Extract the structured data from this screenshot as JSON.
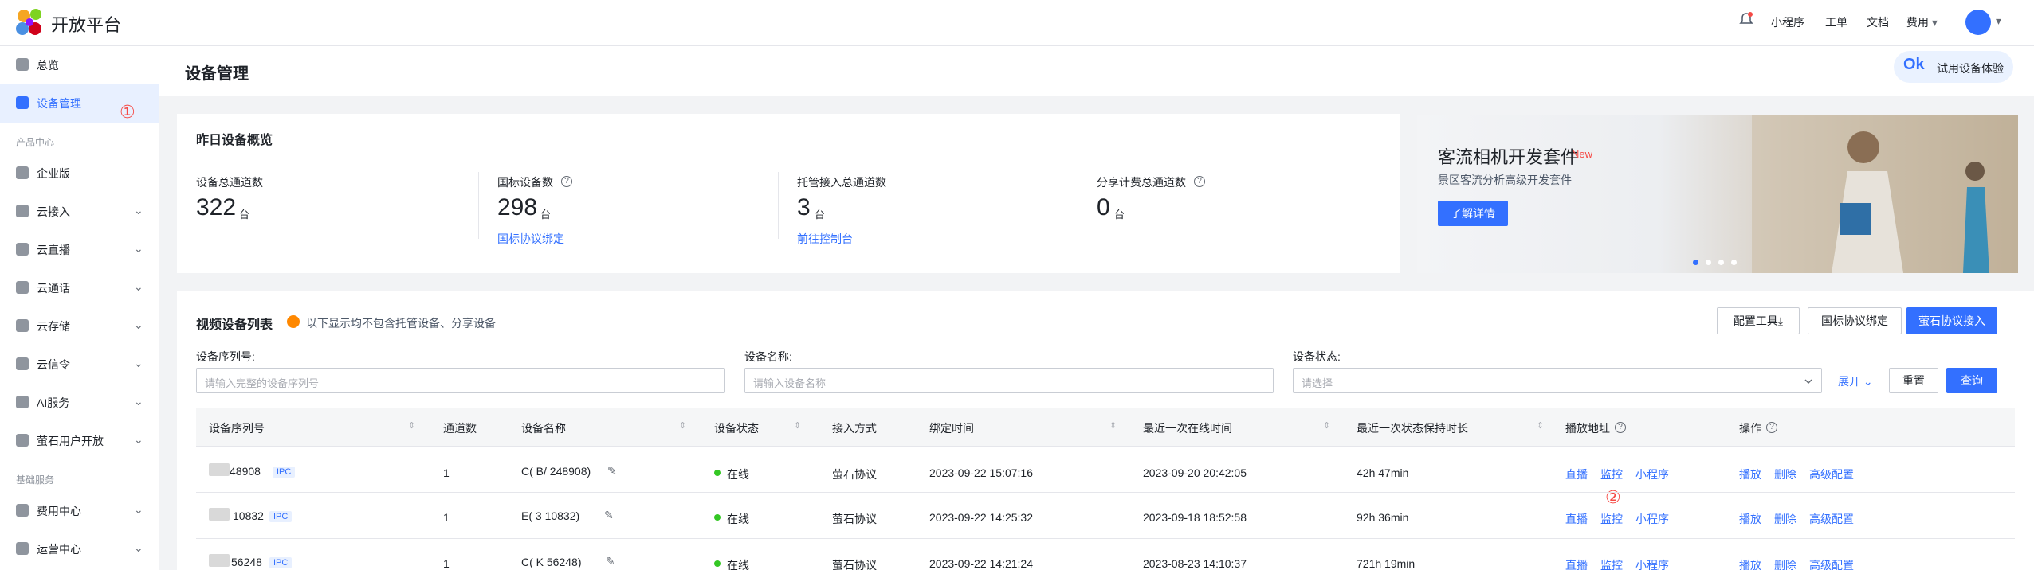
{
  "topbar": {
    "brand": "开放平台",
    "nav": [
      "小程序",
      "工单",
      "文档",
      "费用"
    ],
    "fee_chevron": "▾",
    "avatar_chevron": "▾"
  },
  "sidebar": {
    "items": [
      {
        "label": "总览",
        "icon": "home-icon"
      },
      {
        "label": "设备管理",
        "icon": "device-icon",
        "active": true
      }
    ],
    "group1": "产品中心",
    "product_items": [
      {
        "label": "企业版",
        "icon": "building-icon",
        "chevron": ""
      },
      {
        "label": "云接入",
        "icon": "cloud-link-icon",
        "chevron": "⌄"
      },
      {
        "label": "云直播",
        "icon": "cloud-live-icon",
        "chevron": "⌄"
      },
      {
        "label": "云通话",
        "icon": "phone-icon",
        "chevron": "⌄"
      },
      {
        "label": "云存储",
        "icon": "storage-icon",
        "chevron": "⌄"
      },
      {
        "label": "云信令",
        "icon": "signal-icon",
        "chevron": "⌄"
      },
      {
        "label": "AI服务",
        "icon": "ai-icon",
        "chevron": "⌄"
      },
      {
        "label": "萤石用户开放",
        "icon": "user-open-icon",
        "chevron": "⌄"
      }
    ],
    "group2": "基础服务",
    "base_items": [
      {
        "label": "费用中心",
        "icon": "fee-icon",
        "chevron": "⌄"
      },
      {
        "label": "运营中心",
        "icon": "ops-icon",
        "chevron": "⌄"
      }
    ],
    "marker": "①"
  },
  "page": {
    "title": "设备管理",
    "try_button": "试用设备体验",
    "try_icon_text": "Ok"
  },
  "overview": {
    "title": "昨日设备概览",
    "stats": [
      {
        "label": "设备总通道数",
        "value": "322",
        "unit": "台",
        "link": "",
        "help": ""
      },
      {
        "label": "国标设备数",
        "value": "298",
        "unit": "台",
        "link": "国标协议绑定",
        "help": "?"
      },
      {
        "label": "托管接入总通道数",
        "value": "3",
        "unit": "台",
        "link": "前往控制台",
        "help": ""
      },
      {
        "label": "分享计费总通道数",
        "value": "0",
        "unit": "台",
        "link": "",
        "help": "?"
      }
    ]
  },
  "banner": {
    "title": "客流相机开发套件",
    "badge": "New",
    "subtitle": "景区客流分析高级开发套件",
    "button": "了解详情",
    "slides": 4,
    "active_slide": 0
  },
  "list": {
    "title": "视频设备列表",
    "notice": "以下显示均不包含托管设备、分享设备",
    "buttons": {
      "config_tool": "配置工具⤓",
      "gb_bind": "国标协议绑定",
      "ys_access": "萤石协议接入"
    },
    "filters": {
      "serial_label": "设备序列号:",
      "serial_placeholder": "请输入完整的设备序列号",
      "name_label": "设备名称:",
      "name_placeholder": "请输入设备名称",
      "status_label": "设备状态:",
      "status_placeholder": "请选择",
      "expand": "展开",
      "reset": "重置",
      "query": "查询"
    },
    "columns": [
      "设备序列号",
      "通道数",
      "设备名称",
      "设备状态",
      "接入方式",
      "绑定时间",
      "最近一次在线时间",
      "最近一次状态保持时长",
      "播放地址",
      "操作"
    ],
    "rows": [
      {
        "serial": "48908",
        "tag": "IPC",
        "channels": "1",
        "name": "C(  B/  248908)",
        "status": "在线",
        "access": "萤石协议",
        "bind_time": "2023-09-22 15:07:16",
        "last_online": "2023-09-20 20:42:05",
        "duration": "42h 47min"
      },
      {
        "serial": "10832",
        "tag": "IPC",
        "channels": "1",
        "name": "E(  3  10832)",
        "status": "在线",
        "access": "萤石协议",
        "bind_time": "2023-09-22 14:25:32",
        "last_online": "2023-09-18 18:52:58",
        "duration": "92h 36min"
      },
      {
        "serial": "56248",
        "tag": "IPC",
        "channels": "1",
        "name": "C(  K  56248)",
        "status": "在线",
        "access": "萤石协议",
        "bind_time": "2023-09-22 14:21:24",
        "last_online": "2023-08-23 14:10:37",
        "duration": "721h 19min"
      }
    ],
    "play_links": [
      "直播",
      "监控",
      "小程序"
    ],
    "op_links": [
      "播放",
      "删除",
      "高级配置"
    ],
    "marker": "②"
  }
}
